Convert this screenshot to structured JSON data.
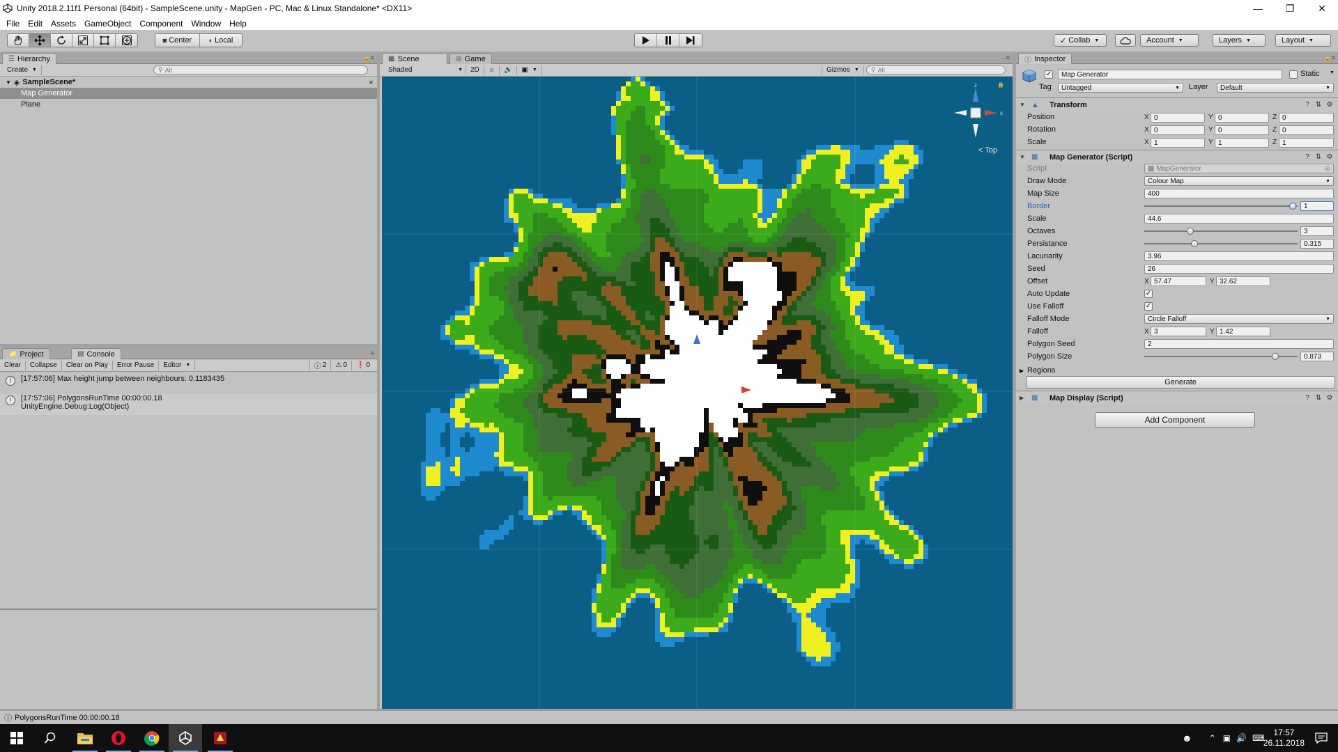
{
  "window": {
    "title": "Unity 2018.2.11f1 Personal (64bit) - SampleScene.unity - MapGen - PC, Mac & Linux Standalone* <DX11>"
  },
  "menu": [
    "File",
    "Edit",
    "Assets",
    "GameObject",
    "Component",
    "Window",
    "Help"
  ],
  "toolbar": {
    "tools": [
      "hand-icon",
      "move-icon",
      "rotate-icon",
      "scale-icon",
      "rect-icon",
      "transform-icon"
    ],
    "pivot_mode": "Center",
    "pivot_rotation": "Local",
    "collab": "Collab",
    "account": "Account",
    "layers": "Layers",
    "layout": "Layout"
  },
  "hierarchy": {
    "tab": "Hierarchy",
    "create": "Create",
    "search_placeholder": "All",
    "scene": "SampleScene*",
    "items": [
      {
        "label": "Map Generator",
        "selected": true
      },
      {
        "label": "Plane",
        "selected": false
      }
    ]
  },
  "console": {
    "tabs": [
      "Project",
      "Console"
    ],
    "buttons": [
      "Clear",
      "Collapse",
      "Clear on Play",
      "Error Pause",
      "Editor"
    ],
    "counts": {
      "info": "2",
      "warn": "0",
      "error": "0"
    },
    "entries": [
      {
        "line1": "[17:57:06] Max height jump between neighbours: 0.1183435",
        "line2": ""
      },
      {
        "line1": "[17:57:06] PolygonsRunTime 00:00:00.18",
        "line2": "UnityEngine.Debug:Log(Object)"
      }
    ]
  },
  "scene": {
    "tabs": [
      "Scene",
      "Game"
    ],
    "shading": "Shaded",
    "mode_2d": "2D",
    "gizmos": "Gizmos",
    "search_placeholder": "All",
    "gizmo_label": "Top",
    "colors": {
      "water": "#0b5f87",
      "shallow": "#1e8bd1",
      "sand": "#f0f020",
      "grass": "#3bab1c",
      "forest": "#2d8a1b",
      "rock": "#3f6e37",
      "dark_forest": "#195b14",
      "dirt": "#8a5b23",
      "peak": "#0f0f0f",
      "snow": "#ffffff"
    }
  },
  "inspector": {
    "tab": "Inspector",
    "object_name": "Map Generator",
    "static_label": "Static",
    "tag_label": "Tag",
    "tag_value": "Untagged",
    "layer_label": "Layer",
    "layer_value": "Default",
    "transform": {
      "title": "Transform",
      "rows": [
        {
          "label": "Position",
          "x": "0",
          "y": "0",
          "z": "0"
        },
        {
          "label": "Rotation",
          "x": "0",
          "y": "0",
          "z": "0"
        },
        {
          "label": "Scale",
          "x": "1",
          "y": "1",
          "z": "1"
        }
      ]
    },
    "map_generator": {
      "title": "Map Generator (Script)",
      "script_label": "Script",
      "script_value": "MapGenerator",
      "draw_mode_label": "Draw Mode",
      "draw_mode": "Colour Map",
      "map_size_label": "Map Size",
      "map_size": "400",
      "border_label": "Border",
      "border": "1",
      "border_fraction": 0.99,
      "scale_label": "Scale",
      "scale": "44.6",
      "octaves_label": "Octaves",
      "octaves": "3",
      "octaves_fraction": 0.29,
      "persistance_label": "Persistance",
      "persistance": "0.315",
      "persistance_fraction": 0.32,
      "lacunarity_label": "Lacunarity",
      "lacunarity": "3.96",
      "seed_label": "Seed",
      "seed": "26",
      "offset_label": "Offset",
      "offset_x": "57.47",
      "offset_y": "32.62",
      "auto_update_label": "Auto Update",
      "use_falloff_label": "Use Falloff",
      "falloff_mode_label": "Falloff Mode",
      "falloff_mode": "Circle Falloff",
      "falloff_label": "Falloff",
      "falloff_x": "3",
      "falloff_y": "1.42",
      "polygon_seed_label": "Polygon Seed",
      "polygon_seed": "2",
      "polygon_size_label": "Polygon Size",
      "polygon_size": "0.873",
      "polygon_size_fraction": 0.87,
      "regions_label": "Regions",
      "generate": "Generate"
    },
    "map_display": {
      "title": "Map Display (Script)"
    },
    "add_component": "Add Component"
  },
  "status": {
    "message": "PolygonsRunTime 00:00:00.18"
  },
  "taskbar": {
    "time": "17:57",
    "date": "26.11.2018"
  }
}
